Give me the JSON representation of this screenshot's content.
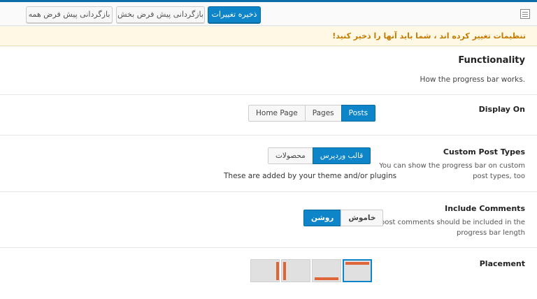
{
  "toolbar": {
    "reset_all_label": "بازگردانی پیش فرض همه",
    "reset_section_label": "بازگردانی پیش فرض بخش",
    "save_label": "ذخیره تغییرات"
  },
  "notice": {
    "text": "تنظیمات تغییر کرده اند ، شما باید آنها را ذخیر کنید!",
    "color": "#c47a00"
  },
  "section": {
    "title": "Functionality",
    "description": "How the progress bar works."
  },
  "display_on": {
    "label": "Display On",
    "options": [
      "Home Page",
      "Pages",
      "Posts"
    ],
    "selected": "Posts"
  },
  "custom_post_types": {
    "label": "Custom Post Types",
    "description": "You can show the progress bar on custom post types, too",
    "options": [
      "محصولات",
      "قالب وردپرس"
    ],
    "selected": "قالب وردپرس",
    "note": "These are added by your theme and/or plugins"
  },
  "include_comments": {
    "label": "Include Comments",
    "description": "The post comments should be included in the progress bar length",
    "options": [
      "روشن",
      "خاموش"
    ],
    "selected": "روشن"
  },
  "placement": {
    "label": "Placement",
    "options": [
      "left",
      "right",
      "bottom",
      "top"
    ],
    "selected": "top",
    "icon": "placement-option-icon"
  },
  "colors": {
    "accent": "#0d85c8",
    "bar": "#e0643a",
    "top_line": "#0b6ea7"
  }
}
